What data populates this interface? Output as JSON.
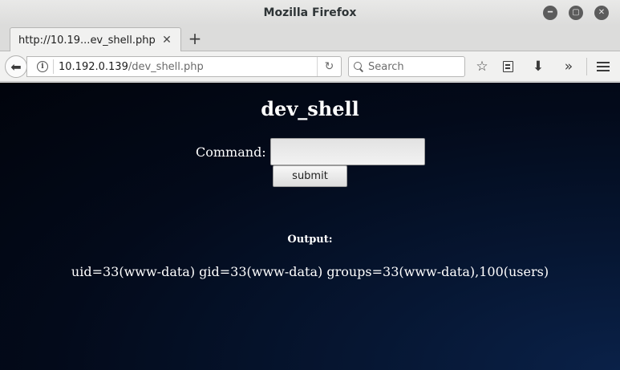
{
  "window": {
    "title": "Mozilla Firefox",
    "controls": [
      "minimize",
      "maximize",
      "close"
    ]
  },
  "tabs": [
    {
      "label": "http://10.19...ev_shell.php",
      "active": true
    }
  ],
  "navbar": {
    "url_host": "10.192.0.139",
    "url_path": "/dev_shell.php",
    "search_placeholder": "Search",
    "icons": [
      "back-icon",
      "info-icon",
      "reload-icon",
      "search-icon",
      "bookmark-star-icon",
      "reader-list-icon",
      "download-icon",
      "overflow-chevron-icon",
      "hamburger-menu-icon"
    ]
  },
  "page": {
    "title": "dev_shell",
    "command_label": "Command:",
    "command_value": "",
    "submit_label": "submit",
    "output_heading": "Output:",
    "output_text": "uid=33(www-data) gid=33(www-data) groups=33(www-data),100(users)",
    "background_colors": [
      "#01040c",
      "#0a2148"
    ]
  }
}
